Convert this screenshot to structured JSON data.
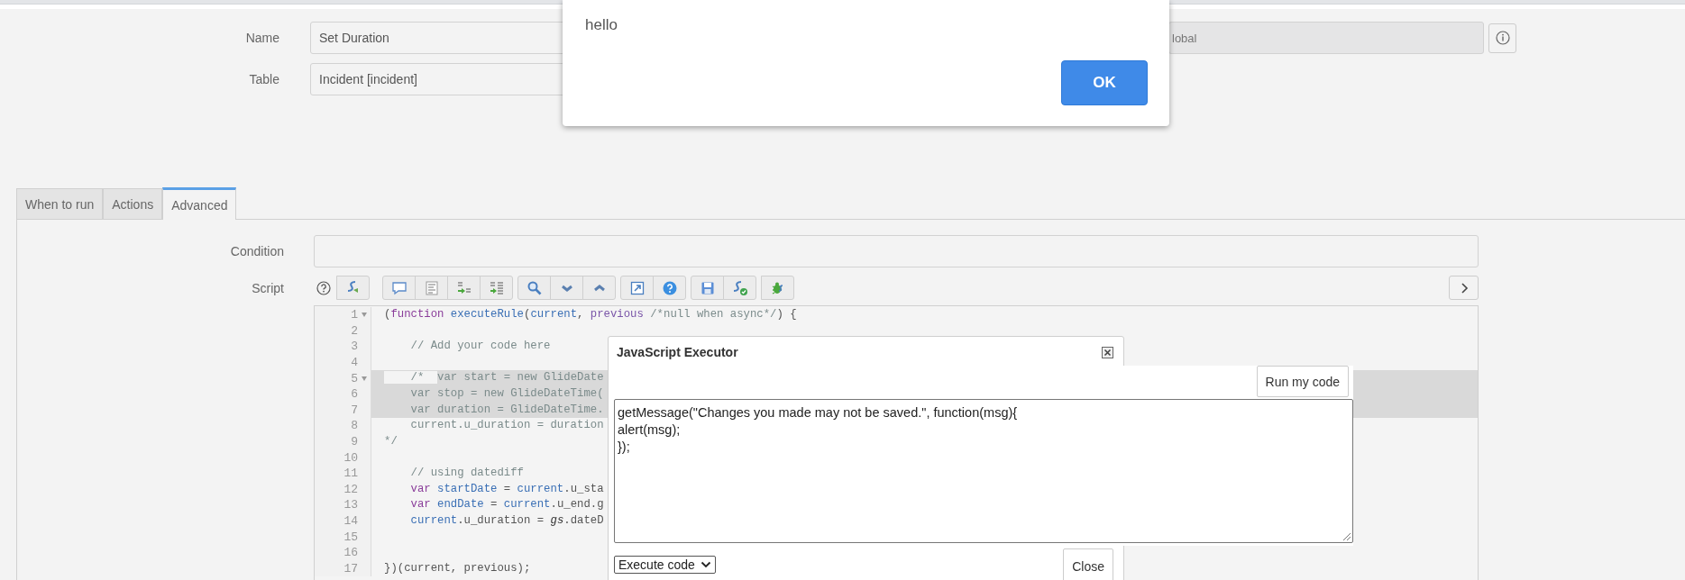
{
  "form": {
    "fields": [
      {
        "label": "Name",
        "value": "Set Duration"
      },
      {
        "label": "Table",
        "value": "Incident [incident]"
      }
    ],
    "scope_field": {
      "value": "lobal",
      "disabled": true
    }
  },
  "alert": {
    "message": "hello",
    "button": "OK"
  },
  "tabs": [
    {
      "label": "When to run",
      "selected": false
    },
    {
      "label": "Actions",
      "selected": false
    },
    {
      "label": "Advanced",
      "selected": true
    }
  ],
  "condition": {
    "label": "Condition"
  },
  "script": {
    "label": "Script",
    "lines": [
      {
        "number": "1",
        "foldable": true,
        "highlighted": false,
        "tokens": [
          {
            "kind": "plain",
            "text": "("
          },
          {
            "kind": "keyword",
            "text": "function"
          },
          {
            "kind": "def",
            "text": " executeRule"
          },
          {
            "kind": "plain",
            "text": "("
          },
          {
            "kind": "def",
            "text": "current"
          },
          {
            "kind": "plain",
            "text": ", "
          },
          {
            "kind": "param",
            "text": "previous"
          },
          {
            "kind": "comment",
            "text": " /*null when async*/"
          },
          {
            "kind": "plain",
            "text": ") {"
          }
        ]
      },
      {
        "number": "2",
        "foldable": false,
        "highlighted": false
      },
      {
        "number": "3",
        "foldable": false,
        "highlighted": false,
        "tokens": [
          {
            "kind": "comment",
            "text": "    // Add your code here"
          }
        ]
      },
      {
        "number": "4",
        "foldable": false,
        "highlighted": false
      },
      {
        "number": "5",
        "foldable": true,
        "highlighted": true,
        "tokens": [
          {
            "kind": "comment",
            "text": "    /*  ",
            "selected": false
          },
          {
            "kind": "comment",
            "text": "var start = new GlideDate",
            "selected": true
          }
        ]
      },
      {
        "number": "6",
        "foldable": false,
        "highlighted": true,
        "tokens": [
          {
            "kind": "comment",
            "text": "    var stop = new GlideDateTime("
          }
        ]
      },
      {
        "number": "7",
        "foldable": false,
        "highlighted": true,
        "tokens": [
          {
            "kind": "comment",
            "text": "    var duration = GlideDateTime."
          }
        ]
      },
      {
        "number": "8",
        "foldable": false,
        "highlighted": false,
        "tokens": [
          {
            "kind": "comment",
            "text": "    current.u_duration = duration"
          }
        ]
      },
      {
        "number": "9",
        "foldable": false,
        "highlighted": false,
        "tokens": [
          {
            "kind": "comment",
            "text": "*/"
          }
        ]
      },
      {
        "number": "10",
        "foldable": false,
        "highlighted": false
      },
      {
        "number": "11",
        "foldable": false,
        "highlighted": false,
        "tokens": [
          {
            "kind": "comment",
            "text": "    // using datediff"
          }
        ]
      },
      {
        "number": "12",
        "foldable": false,
        "highlighted": false,
        "tokens": [
          {
            "kind": "keyword",
            "text": "    var"
          },
          {
            "kind": "def",
            "text": " startDate"
          },
          {
            "kind": "plain",
            "text": " = "
          },
          {
            "kind": "def",
            "text": "current"
          },
          {
            "kind": "plain",
            "text": ".u_sta"
          }
        ]
      },
      {
        "number": "13",
        "foldable": false,
        "highlighted": false,
        "tokens": [
          {
            "kind": "keyword",
            "text": "    var"
          },
          {
            "kind": "def",
            "text": " endDate"
          },
          {
            "kind": "plain",
            "text": " = "
          },
          {
            "kind": "def",
            "text": "current"
          },
          {
            "kind": "plain",
            "text": ".u_end.g"
          }
        ]
      },
      {
        "number": "14",
        "foldable": false,
        "highlighted": false,
        "tokens": [
          {
            "kind": "def",
            "text": "    current"
          },
          {
            "kind": "plain",
            "text": ".u_duration = "
          },
          {
            "kind": "global",
            "text": "gs"
          },
          {
            "kind": "plain",
            "text": ".dateD"
          }
        ]
      },
      {
        "number": "15",
        "foldable": false,
        "highlighted": false
      },
      {
        "number": "16",
        "foldable": false,
        "highlighted": false
      },
      {
        "number": "17",
        "foldable": false,
        "highlighted": false,
        "tokens": [
          {
            "kind": "plain",
            "text": "})(current, previous);"
          }
        ]
      }
    ]
  },
  "executor": {
    "title": "JavaScript Executor",
    "run_button": "Run my code",
    "code": [
      "getMessage(\"Changes you made may not be saved.\", function(msg){",
      "alert(msg);",
      "});"
    ],
    "mode": "Execute code",
    "close_button": "Close"
  }
}
